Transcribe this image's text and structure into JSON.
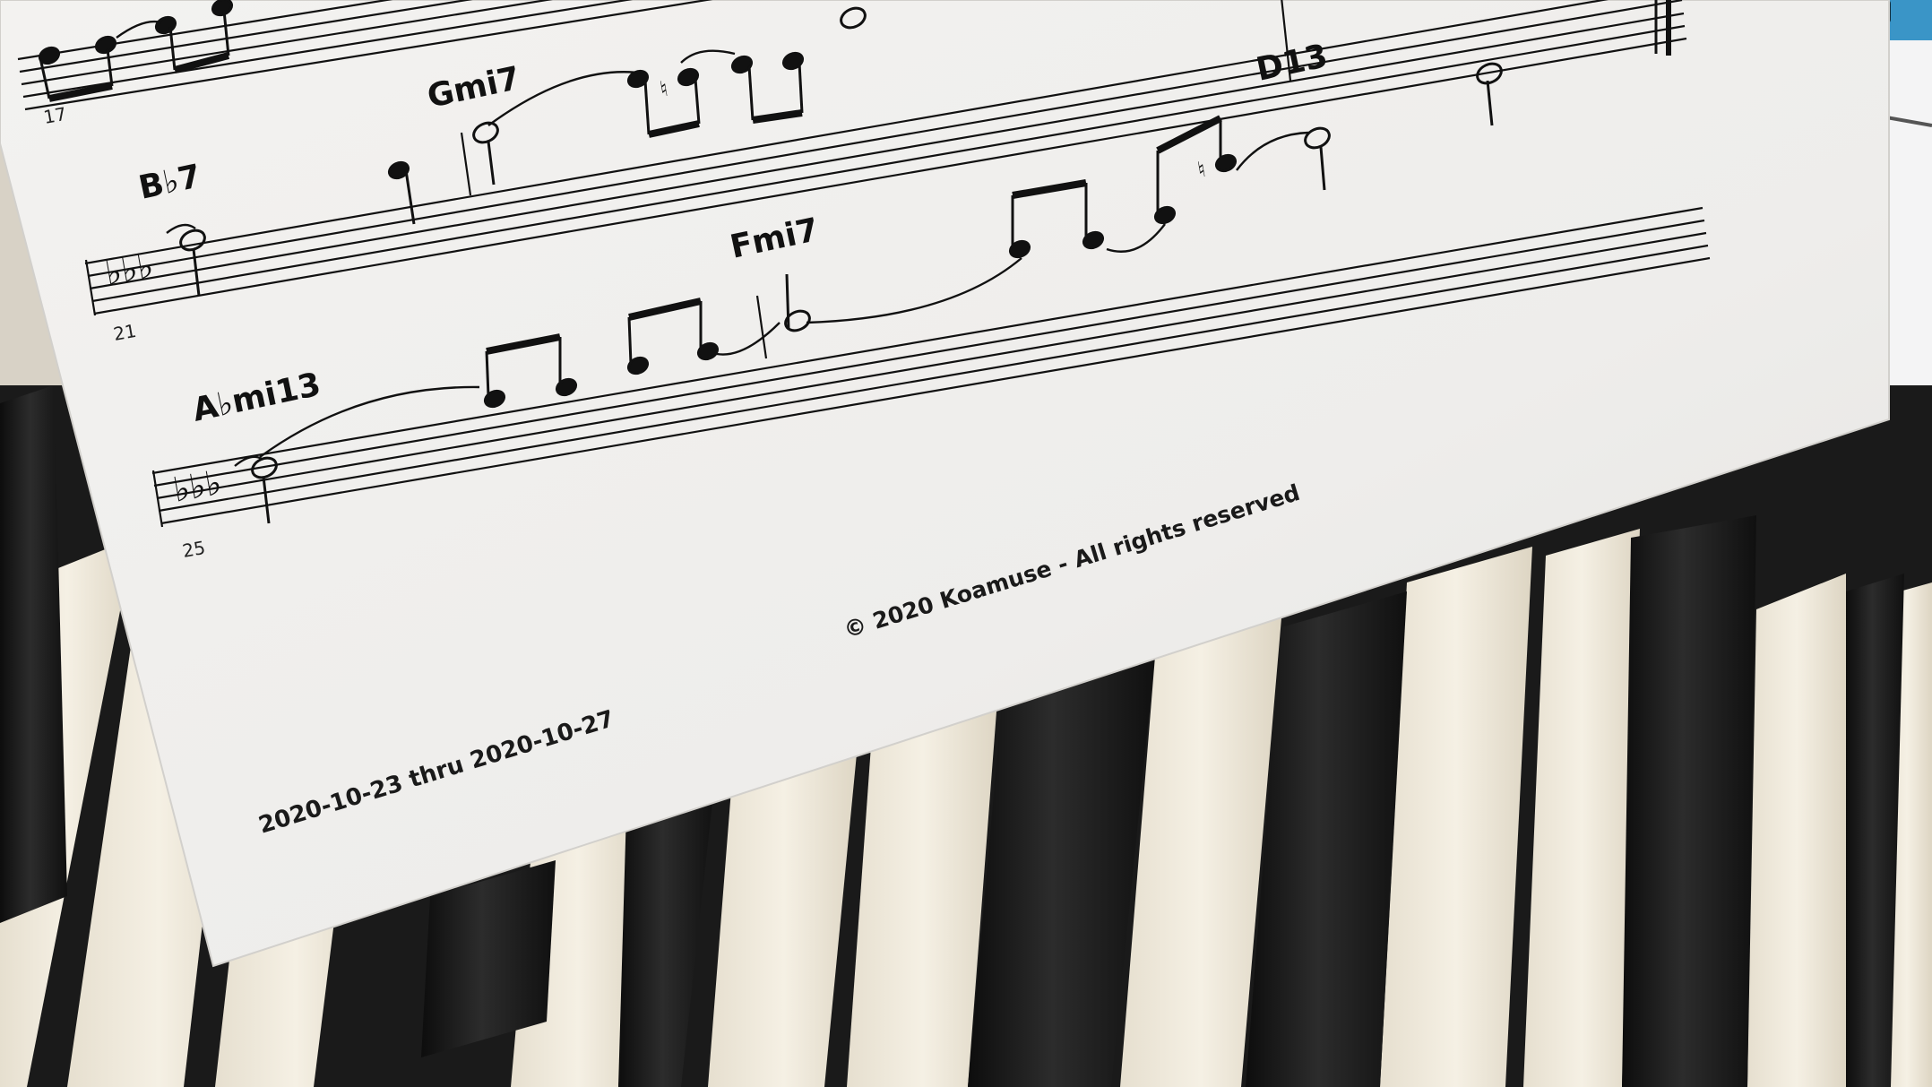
{
  "sheet": {
    "chords": {
      "c1": "B♭7",
      "c2": "Gmi7",
      "c3": "D13",
      "c4": "Fmi7",
      "c5": "A♭mi13"
    },
    "bar_numbers": {
      "b1": "17",
      "b2": "21",
      "b3": "25"
    },
    "copyright": "© 2020 Koamuse - All rights reserved",
    "date_range": "2020-10-23 thru 2020-10-27"
  },
  "colors": {
    "paper": "#f1f0ee",
    "ink": "#111111",
    "white_key": "#efe9da",
    "black_key": "#1b1b1b",
    "keyboard_accent": "#3a95c7"
  }
}
